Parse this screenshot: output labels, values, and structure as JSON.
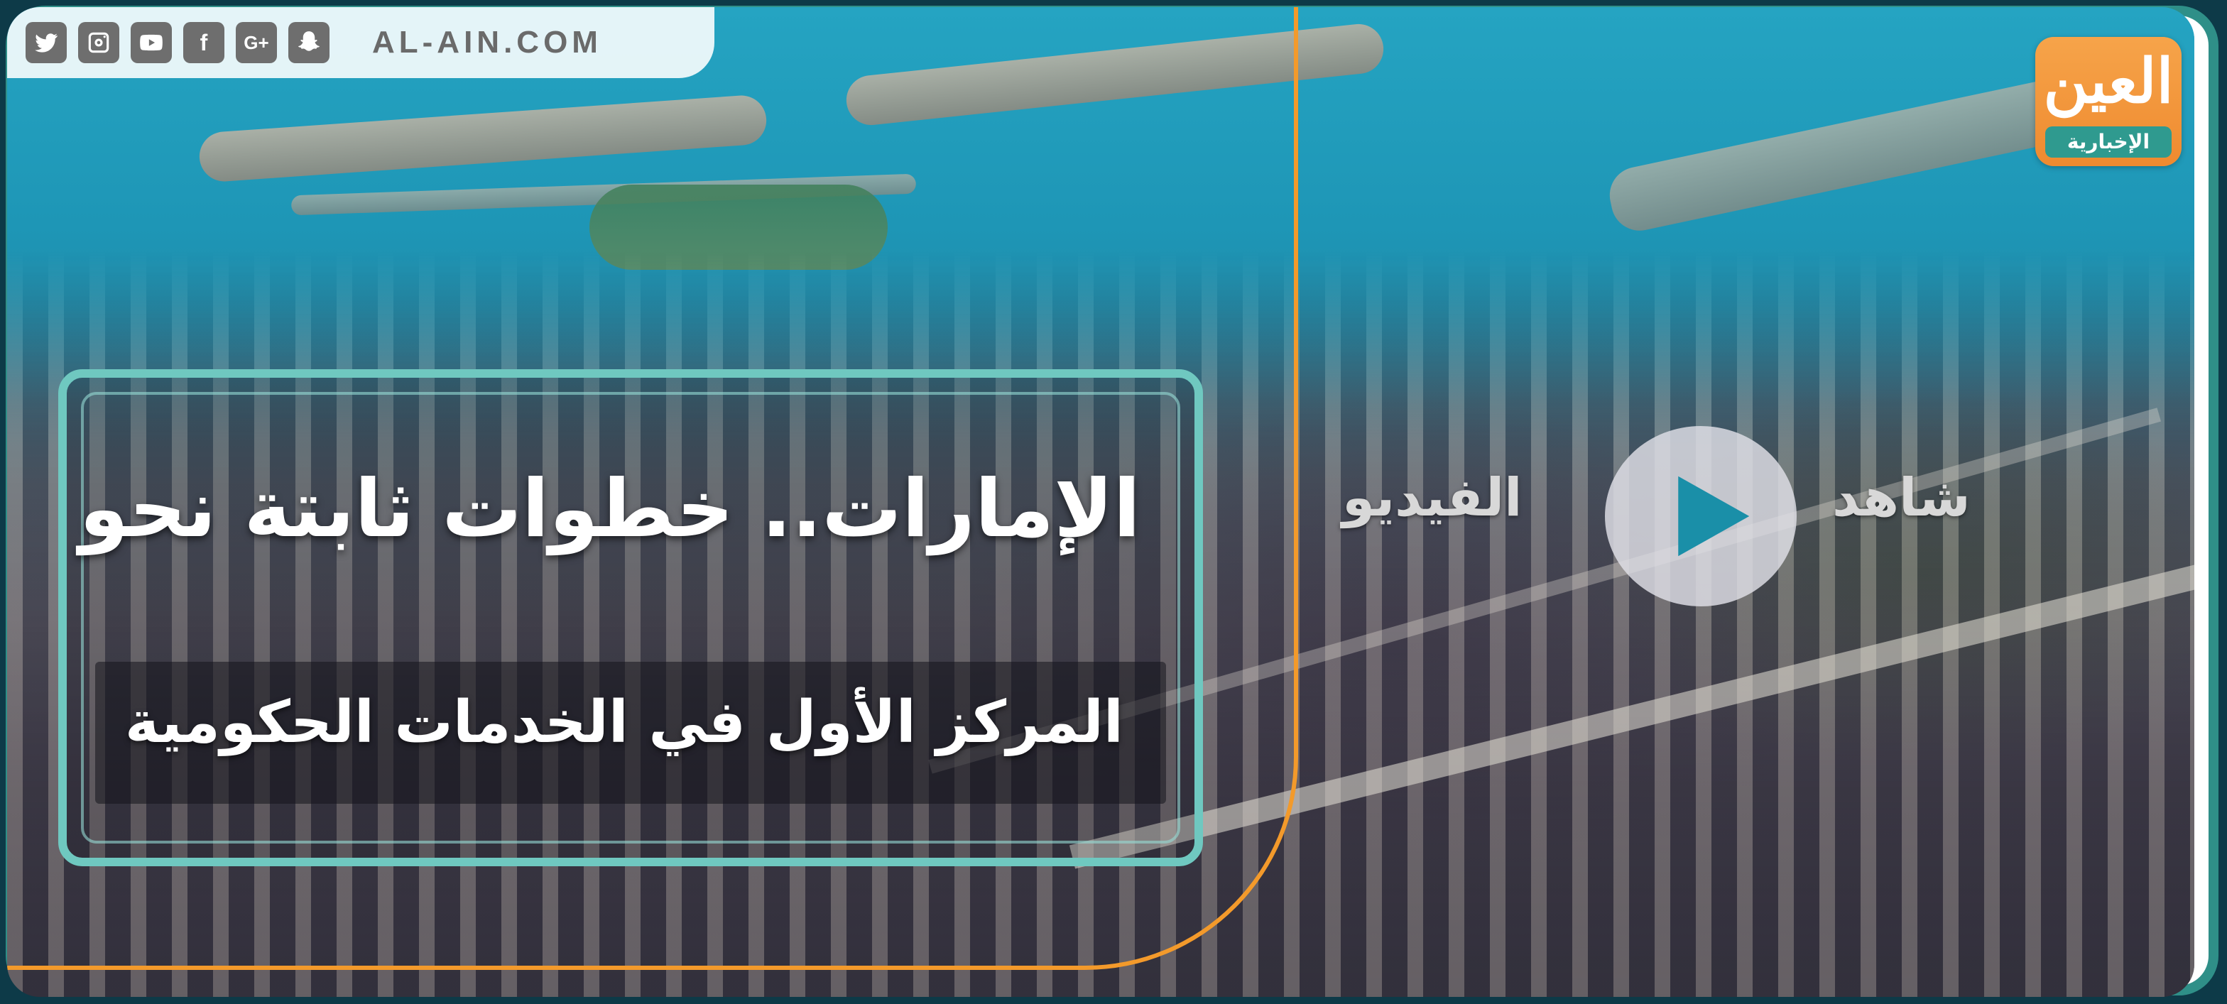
{
  "site": {
    "url": "AL-AIN.COM",
    "social_icons": [
      "twitter-icon",
      "instagram-icon",
      "youtube-icon",
      "facebook-icon",
      "google-plus-icon",
      "snapchat-icon"
    ],
    "google_plus_label": "G+",
    "facebook_label": "f"
  },
  "logo": {
    "main": "العين",
    "sub": "الإخبارية"
  },
  "headline": {
    "line1": "الإمارات.. خطوات ثابتة نحو",
    "line2": "المركز الأول في الخدمات الحكومية"
  },
  "cta": {
    "watch": "شاهد",
    "video": "الفيديو"
  },
  "colors": {
    "accent_orange": "#f39a2b",
    "frame_teal": "#2f8f88",
    "headline_border": "#6fc8c0"
  }
}
